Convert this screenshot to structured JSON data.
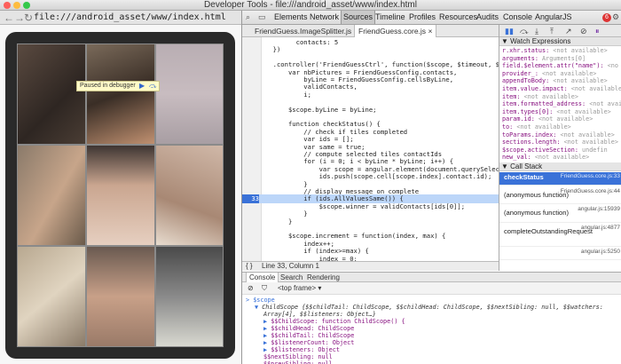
{
  "window": {
    "title": "Developer Tools - file:///android_asset/www/index.html"
  },
  "browser": {
    "url": "file:///android_asset/www/index.html",
    "back_glyph": "←",
    "forward_glyph": "→",
    "reload_glyph": "↻"
  },
  "debugger_overlay": {
    "label": "Paused in debugger",
    "resume_glyph": "▶",
    "step_glyph": "⤼"
  },
  "devtools_tabs": [
    "Elements",
    "Network",
    "Sources",
    "Timeline",
    "Profiles",
    "Resources",
    "Audits",
    "Console",
    "AngularJS"
  ],
  "devtools_active_tab": "Sources",
  "error_count": "6",
  "file_tabs": [
    {
      "label": "FriendGuess.ImageSplitter.js",
      "close": "×"
    },
    {
      "label": "FriendGuess.core.js",
      "close": "×"
    }
  ],
  "code_lines": [
    {
      "ln": "",
      "text": "        contacts: 5"
    },
    {
      "ln": "",
      "text": "  })"
    },
    {
      "ln": "",
      "text": ""
    },
    {
      "ln": "",
      "text": "  .controller('FriendGuessCtrl', function($scope, $timeout, $window"
    },
    {
      "ln": "",
      "text": "      var nbPictures = FriendGuessConfig.contacts,"
    },
    {
      "ln": "",
      "text": "          byLine = FriendGuessConfig.cellsByLine,"
    },
    {
      "ln": "",
      "text": "          validContacts,"
    },
    {
      "ln": "",
      "text": "          i;"
    },
    {
      "ln": "",
      "text": ""
    },
    {
      "ln": "",
      "text": "      $scope.byLine = byLine;"
    },
    {
      "ln": "",
      "text": ""
    },
    {
      "ln": "",
      "text": "      function checkStatus() {"
    },
    {
      "ln": "",
      "text": "          // check if tiles completed"
    },
    {
      "ln": "",
      "text": "          var ids = [];"
    },
    {
      "ln": "",
      "text": "          var same = true;"
    },
    {
      "ln": "",
      "text": "          // compute selected tiles contactIds"
    },
    {
      "ln": "",
      "text": "          for (i = 0; i < byLine * byLine; i++) {"
    },
    {
      "ln": "",
      "text": "              var scope = angular.element(document.querySelector('#"
    },
    {
      "ln": "",
      "text": "              ids.push(scope.cell[scope.index].contact.id);"
    },
    {
      "ln": "",
      "text": "          }"
    },
    {
      "ln": "",
      "text": "          // display message on complete"
    },
    {
      "ln": "33",
      "text": "          if (ids.AllValuesSame()) {",
      "hl": true
    },
    {
      "ln": "",
      "text": "              $scope.winner = validContacts[ids[0]];"
    },
    {
      "ln": "",
      "text": "          }"
    },
    {
      "ln": "",
      "text": "      }"
    },
    {
      "ln": "",
      "text": ""
    },
    {
      "ln": "",
      "text": "      $scope.increment = function(index, max) {"
    },
    {
      "ln": "",
      "text": "          index++;"
    },
    {
      "ln": "",
      "text": "          if (index>=max) {"
    },
    {
      "ln": "",
      "text": "              index = 0;"
    }
  ],
  "code_status": "Line 33, Column 1",
  "code_status_icon": "{ }",
  "watch": {
    "title": "Watch Expressions",
    "items": [
      {
        "name": "r.xhr.status:",
        "value": " <not available>"
      },
      {
        "name": "arguments:",
        "value": " Arguments[0]"
      },
      {
        "name": "field.$element.attr(\"name\"):",
        "value": " <no"
      },
      {
        "name": "provider_:",
        "value": " <not available>"
      },
      {
        "name": "appendToBody:",
        "value": " <not available>"
      },
      {
        "name": "item.value.impact:",
        "value": " <not available"
      },
      {
        "name": "item:",
        "value": " <not available>"
      },
      {
        "name": "item.formatted_address:",
        "value": " <not avai"
      },
      {
        "name": "item.types[0]:",
        "value": " <not available>"
      },
      {
        "name": "param.id:",
        "value": " <not available>"
      },
      {
        "name": "to:",
        "value": " <not available>"
      },
      {
        "name": "toParams.index:",
        "value": " <not available>"
      },
      {
        "name": "sections.length:",
        "value": " <not available>"
      },
      {
        "name": "$scope.activeSection:",
        "value": " undefin"
      },
      {
        "name": "new_val:",
        "value": " <not available>"
      }
    ]
  },
  "callstack": {
    "title": "Call Stack",
    "frames": [
      {
        "name": "checkStatus",
        "loc": "FriendGuess.core.js:33",
        "selected": true
      },
      {
        "name": "(anonymous function)",
        "loc": "FriendGuess.core.js:44"
      },
      {
        "name": "(anonymous function)",
        "loc": "angular.js:15939"
      },
      {
        "name": "completeOutstandingRequest",
        "loc": "angular.js:4877"
      },
      {
        "name": "",
        "loc": "angular.js:5250"
      }
    ]
  },
  "drawer_tabs": [
    "Console",
    "Search",
    "Rendering"
  ],
  "drawer_active": "Console",
  "console_bar": {
    "clear_glyph": "⊘",
    "filter_glyph": "⛉",
    "frame": "<top frame>",
    "frame_arrow": "▾"
  },
  "console_lines": [
    {
      "indent": 0,
      "prefix": "> ",
      "text": "$scope"
    },
    {
      "indent": 1,
      "prefix": "▼ ",
      "text": "ChildScope {$$childTail: ChildScope, $$childHead: ChildScope, $$nextSibling: null, $$watchers:"
    },
    {
      "indent": 2,
      "prefix": "",
      "text": "Array[4], $$listeners: Object…}"
    },
    {
      "indent": 2,
      "prefix": "▶ ",
      "text": "$$ChildScope: function ChildScope() {"
    },
    {
      "indent": 2,
      "prefix": "▶ ",
      "text": "$$childHead: ChildScope"
    },
    {
      "indent": 2,
      "prefix": "▶ ",
      "text": "$$childTail: ChildScope"
    },
    {
      "indent": 2,
      "prefix": "▶ ",
      "text": "$$listenerCount: Object"
    },
    {
      "indent": 2,
      "prefix": "▶ ",
      "text": "$$listeners: Object"
    },
    {
      "indent": 2,
      "prefix": "",
      "text": "$$nextSibling: null"
    },
    {
      "indent": 2,
      "prefix": "",
      "text": "$$prevSibling: null"
    }
  ],
  "debugger_buttons": [
    "▮▮",
    "⤼",
    "⤓",
    "⤒",
    "↗",
    "⊘",
    "⏸"
  ],
  "colors": {
    "highlight_line": "#bcd6f9",
    "selected_frame": "#3a72d8",
    "close_red": "#fc605b",
    "min_yellow": "#fdbc40",
    "max_green": "#34c84a"
  }
}
